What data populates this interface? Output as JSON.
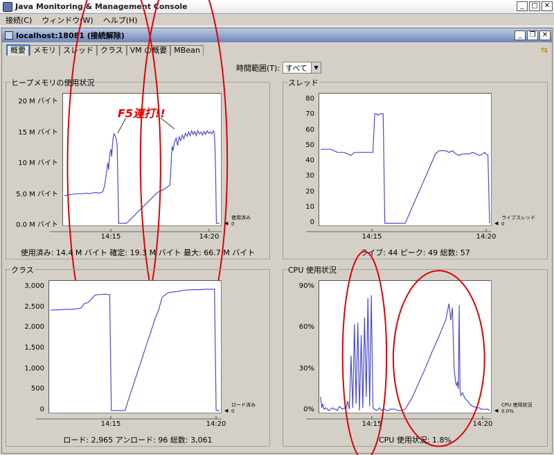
{
  "window": {
    "title": "Java Monitoring & Management Console"
  },
  "menu": [
    {
      "label": "接続(C)"
    },
    {
      "label": "ウィンドウ(W)"
    },
    {
      "label": "ヘルプ(H)"
    }
  ],
  "inner": {
    "title": "localhost:18081 (接続解除)"
  },
  "tabs": [
    {
      "label": "概要"
    },
    {
      "label": "メモリ"
    },
    {
      "label": "スレッド"
    },
    {
      "label": "クラス"
    },
    {
      "label": "VM の概要"
    },
    {
      "label": "MBean"
    }
  ],
  "time_range": {
    "label": "時間範囲(T):",
    "value": "すべて"
  },
  "annotation": "F5連打!!",
  "colors": {
    "series": "#4a4ad0",
    "annotation": "#e00000",
    "title_from": "#b9c9e6",
    "title_to": "#6e86b8"
  },
  "chart_data": [
    {
      "type": "line",
      "title": "ヒープメモリの使用状況",
      "ylim": [
        0,
        20
      ],
      "yticks": [
        "0.0 M バイト",
        "5.0 M バイト",
        "10 M バイト",
        "15 M バイト",
        "20 M バイト"
      ],
      "ytick_values": [
        0,
        5,
        10,
        15,
        20
      ],
      "xtick_labels": [
        "14:15",
        "14:20"
      ],
      "legend": [
        "使用済み",
        "0"
      ],
      "summary": "使用済み: 14.4 M バイト    確定: 19.3 M バイト    最大: 66.7 M バイト",
      "x": [
        0,
        3,
        5,
        8,
        10,
        12,
        14,
        16,
        18,
        20,
        22,
        24,
        25,
        26,
        27,
        28,
        28.5,
        29,
        29.5,
        30,
        30.5,
        31,
        31.5,
        32,
        33,
        33.5,
        34,
        35,
        36,
        36.5,
        37,
        38,
        40,
        44,
        48,
        52,
        56,
        60,
        64,
        66,
        68,
        68.5,
        69,
        69.5,
        70,
        71,
        72,
        73,
        74,
        75,
        76,
        77,
        78,
        79,
        80,
        81,
        82,
        83,
        84,
        85,
        86,
        87,
        88,
        89,
        90,
        91,
        92,
        93,
        94,
        95,
        96,
        96.5,
        97,
        97.5,
        98,
        99,
        100
      ],
      "values": [
        4.5,
        4.6,
        4.7,
        4.8,
        4.8,
        4.8,
        4.9,
        4.8,
        4.9,
        5.0,
        4.9,
        5.0,
        5.3,
        6.2,
        8.0,
        9.8,
        8.7,
        10.5,
        11.5,
        12.0,
        10.8,
        12.8,
        14.0,
        14.5,
        14.0,
        13.6,
        12.5,
        0,
        0,
        0,
        0,
        0,
        0,
        1,
        2,
        3,
        4,
        5,
        5.5,
        5.8,
        6.2,
        8.0,
        11.0,
        12.5,
        11.8,
        13.2,
        13.8,
        12.6,
        14.0,
        13.4,
        14.3,
        13.7,
        14.6,
        14.1,
        14.8,
        14.2,
        15.0,
        14.4,
        14.9,
        14.2,
        15.0,
        14.5,
        14.8,
        14.3,
        14.9,
        14.4,
        15.0,
        14.6,
        14.8,
        14.5,
        15.0,
        14.8,
        13.0,
        8.0,
        0,
        0,
        0
      ],
      "circles": [
        [
          32,
          9.3,
          30,
          33
        ],
        [
          77,
          10.1,
          28,
          32
        ]
      ]
    },
    {
      "type": "line",
      "title": "スレッド",
      "ylim": [
        0,
        80
      ],
      "yticks": [
        "0",
        "10",
        "20",
        "30",
        "40",
        "50",
        "60",
        "70",
        "80"
      ],
      "ytick_values": [
        0,
        10,
        20,
        30,
        40,
        50,
        60,
        70,
        80
      ],
      "xtick_labels": [
        "14:15",
        "14:20"
      ],
      "legend": [
        "ライブスレッド",
        "0"
      ],
      "summary": "ライブ: 44    ピーク: 49    総数: 57",
      "x": [
        0,
        2,
        4,
        6,
        8,
        10,
        12,
        14,
        16,
        18,
        20,
        22,
        24,
        26,
        28,
        30,
        31,
        32,
        33,
        34,
        35,
        36,
        37,
        38,
        40,
        42,
        44,
        46,
        48,
        50,
        52,
        54,
        56,
        58,
        60,
        62,
        64,
        66,
        68,
        70,
        72,
        74,
        76,
        78,
        80,
        82,
        84,
        86,
        88,
        90,
        92,
        94,
        96,
        97,
        98,
        99,
        100
      ],
      "values": [
        48,
        48,
        48,
        48,
        47,
        46,
        46,
        46,
        45,
        44,
        46,
        46,
        46,
        46,
        46,
        46,
        46,
        71,
        71,
        70,
        71,
        71,
        71,
        0,
        0,
        0,
        0,
        0,
        0,
        0,
        5,
        10,
        15,
        20,
        25,
        30,
        35,
        40,
        45,
        47,
        47,
        47,
        46,
        47,
        45,
        44,
        45,
        45,
        45,
        46,
        45,
        44,
        45,
        46,
        45,
        44,
        0
      ],
      "circles": []
    },
    {
      "type": "line",
      "title": "クラス",
      "ylim": [
        0,
        3000
      ],
      "yticks": [
        "0",
        "500",
        "1,000",
        "1,500",
        "2,000",
        "2,500",
        "3,000"
      ],
      "ytick_values": [
        0,
        500,
        1000,
        1500,
        2000,
        2500,
        3000
      ],
      "xtick_labels": [
        "14:15",
        "14:20"
      ],
      "legend": [
        "ロード済み",
        "0"
      ],
      "summary": "ロード: 2,965    アンロード: 96    総数: 3,061",
      "x": [
        0,
        3,
        6,
        9,
        12,
        15,
        18,
        20,
        22,
        24,
        26,
        28,
        30,
        32,
        34,
        35,
        36,
        37,
        38,
        40,
        42,
        44,
        46,
        48,
        50,
        52,
        54,
        56,
        58,
        60,
        62,
        64,
        65,
        66,
        68,
        70,
        72,
        74,
        76,
        78,
        80,
        84,
        88,
        92,
        96,
        97,
        98,
        100
      ],
      "values": [
        2440,
        2450,
        2450,
        2460,
        2460,
        2470,
        2490,
        2600,
        2620,
        2700,
        2800,
        2820,
        2820,
        2830,
        2820,
        2820,
        0,
        0,
        0,
        0,
        0,
        0,
        250,
        500,
        750,
        1000,
        1250,
        1500,
        1750,
        2000,
        2250,
        2450,
        2600,
        2750,
        2820,
        2870,
        2880,
        2890,
        2900,
        2920,
        2930,
        2940,
        2940,
        2950,
        2950,
        2950,
        0,
        0
      ],
      "circles": []
    },
    {
      "type": "line",
      "title": "CPU 使用状況",
      "ylim": [
        0,
        90
      ],
      "yticks": [
        "0%",
        "30%",
        "60%",
        "90%"
      ],
      "ytick_values": [
        0,
        30,
        60,
        90
      ],
      "xtick_labels": [
        "14:15",
        "14:20"
      ],
      "legend": [
        "CPU 使用状況",
        "0.0%"
      ],
      "summary": "CPU 使用状況: 1.8%",
      "x": [
        0,
        0.6,
        1.2,
        2,
        3,
        4,
        5,
        6,
        7,
        8,
        9,
        10,
        11,
        12,
        13,
        14,
        15,
        16,
        17,
        18,
        19,
        20,
        21,
        22,
        23,
        24,
        25,
        26,
        27,
        28,
        29,
        30,
        31,
        32,
        33,
        34,
        35,
        36,
        37,
        38,
        39,
        40,
        41,
        42,
        44,
        46,
        48,
        50,
        54,
        58,
        62,
        66,
        70,
        74,
        76,
        77,
        78,
        79,
        80,
        80.5,
        81,
        81.5,
        82,
        82.5,
        83,
        83.5,
        84,
        85,
        86,
        87,
        88,
        89,
        90,
        91,
        92,
        93,
        94,
        95,
        96,
        97,
        98,
        99,
        100
      ],
      "values": [
        10,
        2,
        5,
        1,
        2,
        1,
        0,
        1,
        2,
        1,
        1,
        0,
        3,
        2,
        1,
        2,
        1,
        7,
        1,
        40,
        2,
        63,
        5,
        64,
        0,
        55,
        2,
        68,
        10,
        82,
        3,
        84,
        2,
        1,
        0,
        1,
        2,
        0,
        1,
        1,
        0,
        0,
        1,
        1,
        1,
        0,
        0,
        1,
        9,
        20,
        31,
        43,
        54,
        66,
        78,
        66,
        75,
        30,
        20,
        18,
        21,
        16,
        77,
        15,
        11,
        12,
        13,
        10,
        8,
        7,
        5,
        4,
        3,
        3,
        2,
        2,
        2,
        1,
        1,
        1,
        1,
        1,
        0
      ],
      "circles": [
        [
          26,
          40,
          13,
          76
        ],
        [
          70,
          38,
          27,
          64
        ]
      ]
    }
  ]
}
